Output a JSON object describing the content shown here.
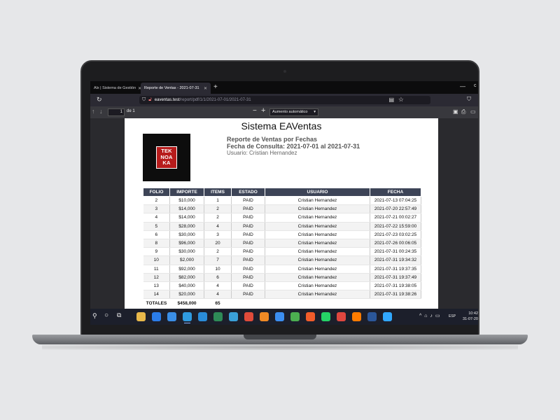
{
  "browser": {
    "tabs": [
      {
        "label": "Alx | Sistema de Gestión",
        "active": false
      },
      {
        "label": "Reporte de Ventas - 2021-07-31",
        "active": true
      }
    ],
    "url_host": "eaventas.test",
    "url_path": "/report/pdf/1/1/2021-07-01/2021-07-31"
  },
  "pdf_toolbar": {
    "page_number": "1",
    "page_total": "de 1",
    "zoom": "Aumento automático"
  },
  "document": {
    "title": "Sistema EAVentas",
    "logo_lines": [
      "TEK",
      "NOA",
      "KA"
    ],
    "report_title": "Reporte de Ventas por Fechas",
    "date_range": "Fecha de Consulta: 2021-07-01 al 2021-07-31",
    "user": "Usuario: Cristian Hernandez",
    "table": {
      "headers": [
        "FOLIO",
        "IMPORTE",
        "ITEMS",
        "ESTADO",
        "USUARIO",
        "FECHA"
      ],
      "rows": [
        [
          "2",
          "$10,000",
          "1",
          "PAID",
          "Cristian Hernandez",
          "2021-07-13 07:04:25"
        ],
        [
          "3",
          "$14,000",
          "2",
          "PAID",
          "Cristian Hernandez",
          "2021-07-20 22:57:49"
        ],
        [
          "4",
          "$14,000",
          "2",
          "PAID",
          "Cristian Hernandez",
          "2021-07-21 00:02:27"
        ],
        [
          "5",
          "$28,000",
          "4",
          "PAID",
          "Cristian Hernandez",
          "2021-07-22 15:59:00"
        ],
        [
          "6",
          "$30,000",
          "3",
          "PAID",
          "Cristian Hernandez",
          "2021-07-23 03:02:25"
        ],
        [
          "8",
          "$96,000",
          "20",
          "PAID",
          "Cristian Hernandez",
          "2021-07-26 00:06:05"
        ],
        [
          "9",
          "$30,000",
          "2",
          "PAID",
          "Cristian Hernandez",
          "2021-07-31 00:24:35"
        ],
        [
          "10",
          "$2,000",
          "7",
          "PAID",
          "Cristian Hernandez",
          "2021-07-31 19:34:32"
        ],
        [
          "11",
          "$92,000",
          "10",
          "PAID",
          "Cristian Hernandez",
          "2021-07-31 19:37:35"
        ],
        [
          "12",
          "$82,000",
          "6",
          "PAID",
          "Cristian Hernandez",
          "2021-07-31 19:37:49"
        ],
        [
          "13",
          "$40,000",
          "4",
          "PAID",
          "Cristian Hernandez",
          "2021-07-31 19:38:05"
        ],
        [
          "14",
          "$20,000",
          "4",
          "PAID",
          "Cristian Hernandez",
          "2021-07-31 19:38:26"
        ]
      ],
      "totals": {
        "label": "TOTALES",
        "amount": "$458,000",
        "items": "65"
      }
    }
  },
  "taskbar": {
    "language": "ESP",
    "time": "10:42",
    "date": "31-07-20",
    "apps": [
      {
        "name": "file-explorer-icon",
        "color": "#e8b84a"
      },
      {
        "name": "mail-icon",
        "color": "#2b7de9"
      },
      {
        "name": "photos-icon",
        "color": "#3a8ee6"
      },
      {
        "name": "edge-icon",
        "color": "#2f9be0",
        "active": true
      },
      {
        "name": "vscode-icon",
        "color": "#2a8cd8"
      },
      {
        "name": "terminal-icon",
        "color": "#2e8b57"
      },
      {
        "name": "git-icon",
        "color": "#3aa0d8"
      },
      {
        "name": "chrome-icon",
        "color": "#e04b3a"
      },
      {
        "name": "postman-icon",
        "color": "#f08a24"
      },
      {
        "name": "messenger-icon",
        "color": "#3b8ef0"
      },
      {
        "name": "chrome-dev-icon",
        "color": "#4caf50"
      },
      {
        "name": "brave-icon",
        "color": "#f25c2a"
      },
      {
        "name": "whatsapp-icon",
        "color": "#25d366"
      },
      {
        "name": "vivaldi-icon",
        "color": "#e0473f"
      },
      {
        "name": "illustrator-icon",
        "color": "#ff7c00"
      },
      {
        "name": "word-icon",
        "color": "#2b579a"
      },
      {
        "name": "photoshop-icon",
        "color": "#31a8ff"
      }
    ]
  }
}
